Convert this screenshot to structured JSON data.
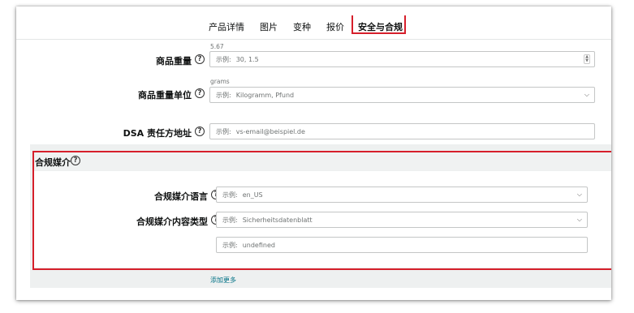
{
  "tabs": [
    {
      "label": "产品详情"
    },
    {
      "label": "图片"
    },
    {
      "label": "变种"
    },
    {
      "label": "报价"
    },
    {
      "label": "安全与合规"
    }
  ],
  "weight": {
    "label": "商品重量",
    "hint": "5.67",
    "placeholder_prefix": "示例:",
    "placeholder": "30, 1.5"
  },
  "weight_unit": {
    "label": "商品重量单位",
    "hint": "grams",
    "placeholder_prefix": "示例:",
    "placeholder": "Kilogramm, Pfund"
  },
  "dsa": {
    "label": "DSA 责任方地址",
    "placeholder_prefix": "示例:",
    "placeholder": "vs-email@beispiel.de"
  },
  "compliance_media": {
    "title": "合规媒介",
    "language": {
      "label": "合规媒介语言",
      "placeholder_prefix": "示例:",
      "placeholder": "en_US"
    },
    "content_type": {
      "label": "合规媒介内容类型",
      "placeholder_prefix": "示例:",
      "placeholder": "Sicherheitsdatenblatt"
    },
    "extra": {
      "placeholder_prefix": "示例:",
      "placeholder": "undefined"
    },
    "add_more": "添加更多"
  },
  "colors": {
    "highlight": "#d61f2b",
    "link": "#007185"
  },
  "icons": {
    "help": "help-circle-icon",
    "chevron": "chevron-down-icon",
    "stepper": "number-stepper-icon"
  }
}
